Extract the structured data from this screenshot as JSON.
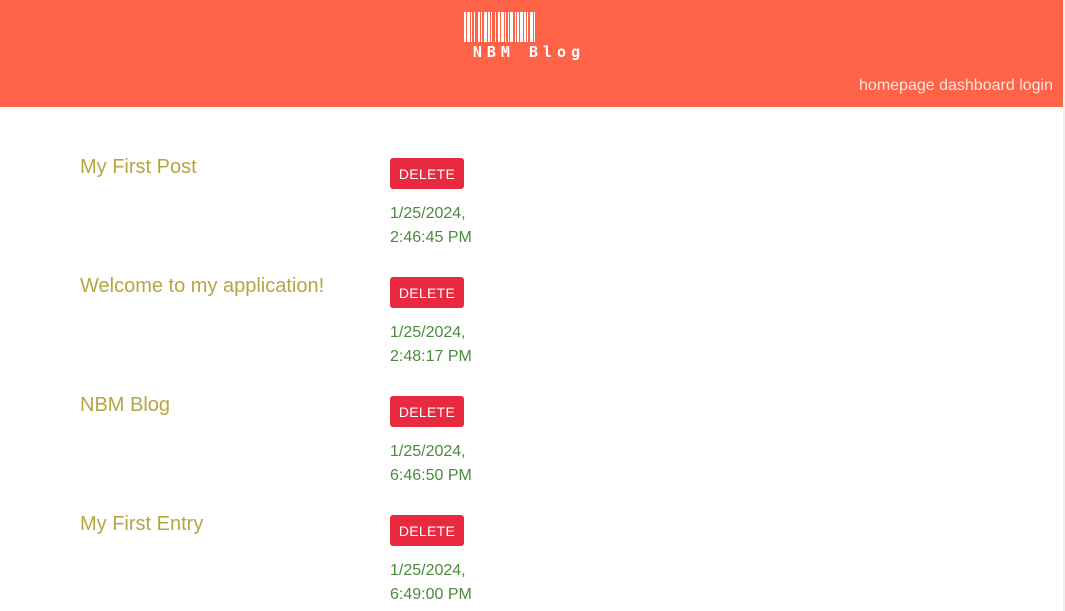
{
  "header": {
    "brand": "NBM Blog",
    "nav": [
      "homepage",
      "dashboard",
      "login"
    ],
    "background_color": "#ff6347"
  },
  "posts": [
    {
      "title": "My First Post",
      "delete_label": "DELETE",
      "date": "1/25/2024, 2:46:45 PM"
    },
    {
      "title": "Welcome to my application!",
      "delete_label": "DELETE",
      "date": "1/25/2024, 2:48:17 PM"
    },
    {
      "title": "NBM Blog",
      "delete_label": "DELETE",
      "date": "1/25/2024, 6:46:50 PM"
    },
    {
      "title": "My First Entry",
      "delete_label": "DELETE",
      "date": "1/25/2024, 6:49:00 PM"
    }
  ],
  "colors": {
    "title": "#b5a642",
    "date": "#4b8a3c",
    "delete_button": "#e8293f"
  },
  "icons": {
    "logo": "barcode-icon"
  }
}
